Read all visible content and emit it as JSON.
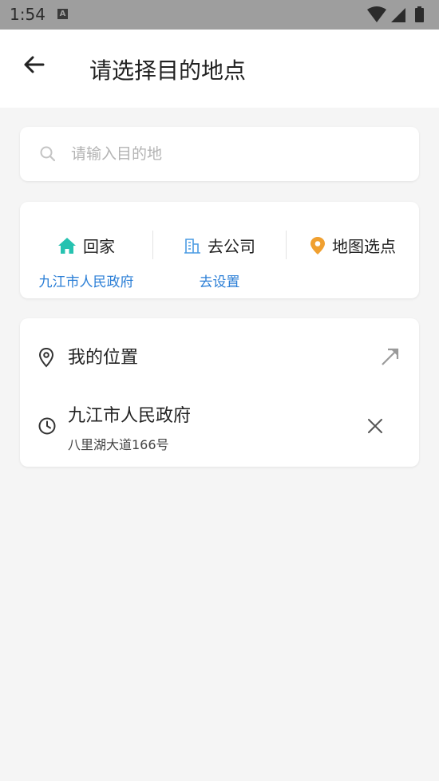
{
  "status_bar": {
    "time": "1:54",
    "notification_icon": "a-icon",
    "icons": [
      "wifi-icon",
      "signal-icon",
      "battery-icon"
    ]
  },
  "header": {
    "title": "请选择目的地点",
    "back_icon": "arrow-left-icon"
  },
  "search": {
    "placeholder": "请输入目的地",
    "value": "",
    "icon": "search-icon"
  },
  "shortcuts": [
    {
      "label": "回家",
      "sub": "九江市人民政府",
      "icon": "home-icon",
      "color": "#26c2b0"
    },
    {
      "label": "去公司",
      "sub": "去设置",
      "icon": "building-icon",
      "color": "#4a9be3"
    },
    {
      "label": "地图选点",
      "sub": "",
      "icon": "map-pin-icon",
      "color": "#f0a030"
    }
  ],
  "locations": {
    "my_position": {
      "label": "我的位置",
      "icon": "location-pin-icon",
      "action_icon": "arrow-up-right-icon"
    },
    "recent": [
      {
        "name": "九江市人民政府",
        "address": "八里湖大道166号",
        "icon": "clock-icon",
        "action_icon": "close-icon"
      }
    ]
  },
  "colors": {
    "accent_link": "#2a7ed6",
    "background": "#f5f5f5",
    "status_bar": "#9e9e9e"
  }
}
